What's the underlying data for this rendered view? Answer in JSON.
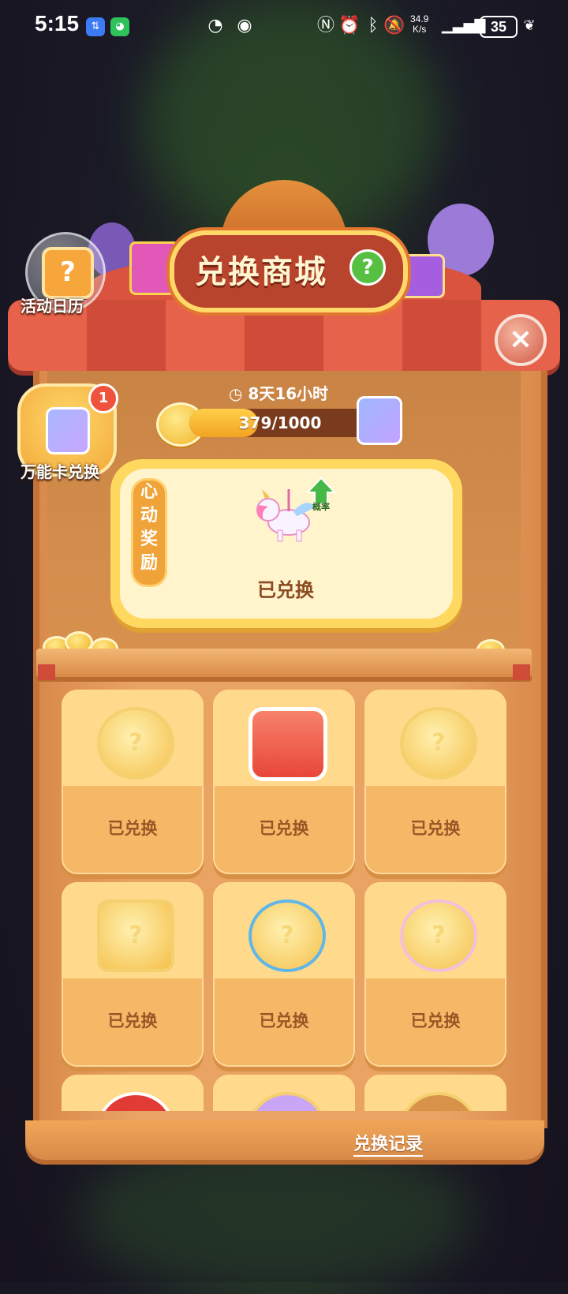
{
  "status_bar": {
    "time": "5:15",
    "speed_value": "34.9",
    "speed_unit": "K/s",
    "battery": "35"
  },
  "header": {
    "title": "兑换商城",
    "help": "?",
    "close": "×"
  },
  "calendar": {
    "label": "活动日历",
    "icon_glyph": "?"
  },
  "universal_card": {
    "label": "万能卡兑换",
    "badge": "1"
  },
  "countdown": "8天16小时",
  "progress": {
    "text": "379/1000",
    "current": 379,
    "max": 1000
  },
  "featured": {
    "tag": [
      "心",
      "动",
      "奖",
      "励"
    ],
    "rate_label": "概率",
    "status": "已兑换"
  },
  "grid": {
    "items": [
      {
        "status": "已兑换",
        "icon": "chicken-frame-icon"
      },
      {
        "status": "已兑换",
        "icon": "avatar-icon"
      },
      {
        "status": "已兑换",
        "icon": "harvest-wreath-icon"
      },
      {
        "status": "已兑换",
        "icon": "lantern-gate-icon"
      },
      {
        "status": "已兑换",
        "icon": "koi-wreath-icon"
      },
      {
        "status": "已兑换",
        "icon": "cow-frame-icon"
      },
      {
        "status": "",
        "icon": "santa-hat-icon"
      },
      {
        "status": "",
        "icon": "unicorn-icon"
      },
      {
        "status": "",
        "icon": "bear-icon"
      }
    ]
  },
  "footer": {
    "record_link": "兑换记录"
  },
  "colors": {
    "accent_red": "#d9533f",
    "wood": "#e9a464",
    "gold": "#ffd860"
  }
}
